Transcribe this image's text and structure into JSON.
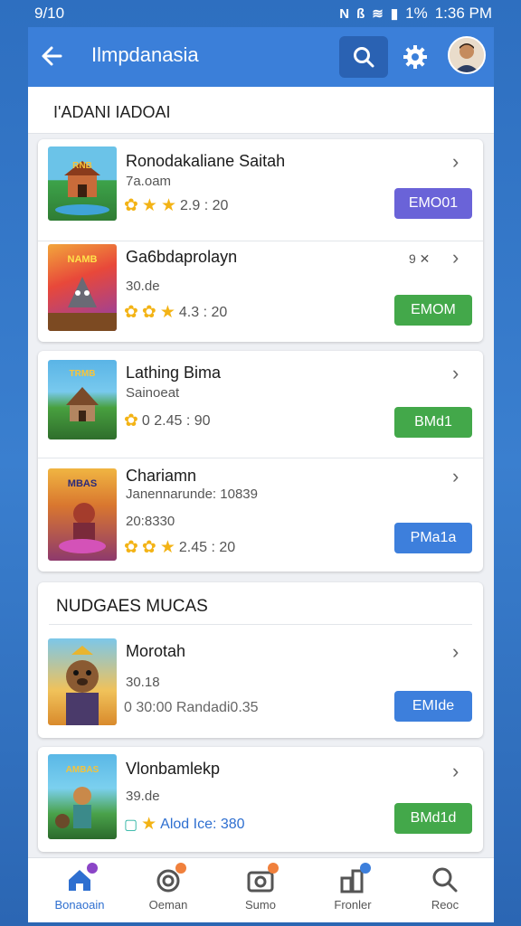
{
  "status_bar": {
    "time": "9/10",
    "battery": "1%",
    "clock": "1:36 PM"
  },
  "app_bar": {
    "title": "Ilmpdanasia",
    "back_icon": "arrow-left-icon",
    "search_icon": "search-icon",
    "settings_icon": "gear-icon"
  },
  "section1": {
    "title": "I'ADANI IADOAI"
  },
  "games": [
    {
      "name": "Ronodakaliane Saitah",
      "sub": "7a.oam",
      "rating": "2.9 : 20",
      "extra": "",
      "button": "EMO01",
      "button_color": "#6a63d8"
    },
    {
      "name": "Ga6bdaprolayn",
      "sub": "30.de",
      "rating": "4.3 : 20",
      "extra": "9 ✕",
      "button": "EMOM",
      "button_color": "#43a84a"
    },
    {
      "name": "Lathing Bima",
      "sub": "Sainoeat",
      "rating": "0  2.45 : 90",
      "extra": "",
      "button": "BMd1",
      "button_color": "#43a84a"
    },
    {
      "name": "Chariamn",
      "sub": "Janennarunde: 10839",
      "sub2": "20:8330",
      "rating": "2.45 : 20",
      "extra": "",
      "button": "PMa1a",
      "button_color": "#3d7fdc"
    }
  ],
  "section2": {
    "title": "NUDGAES MUCAS"
  },
  "games2": [
    {
      "name": "Morotah",
      "sub": "30.18",
      "rating": "0 30:00 Randadi0.35",
      "button": "EMIde",
      "button_color": "#3d7fdc"
    },
    {
      "name": "Vlonbamlekp",
      "sub": "39.de",
      "rating": "Alod Ice: 380",
      "button": "BMd1d",
      "button_color": "#43a84a"
    }
  ],
  "bottom_nav": [
    {
      "label": "Bonaoain",
      "icon": "home-icon",
      "badge_color": "#8b45c7",
      "active": true
    },
    {
      "label": "Oeman",
      "icon": "target-icon",
      "badge_color": "#f0803c",
      "active": false
    },
    {
      "label": "Sumo",
      "icon": "camera-icon",
      "badge_color": "#f0803c",
      "active": false
    },
    {
      "label": "Fronler",
      "icon": "buildings-icon",
      "badge_color": "#3d7fdc",
      "active": false
    },
    {
      "label": "Reoc",
      "icon": "search-icon",
      "badge_color": "",
      "active": false
    }
  ]
}
